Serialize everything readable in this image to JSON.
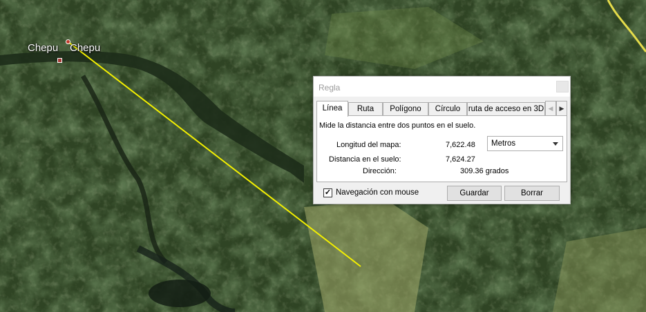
{
  "map": {
    "places": [
      {
        "name": "Chepu"
      },
      {
        "name": "Chepu"
      }
    ],
    "ruler_line_color": "#f4f000",
    "road_color": "#e5dc4a"
  },
  "dialog": {
    "title": "Regla",
    "tabs": [
      "Línea",
      "Ruta",
      "Polígono",
      "Círculo",
      "ruta de acceso en 3D"
    ],
    "active_tab": "Línea",
    "description": "Mide la distancia entre dos puntos en el suelo.",
    "map_length_label": "Longitud del mapa:",
    "map_length_value": "7,622.48",
    "unit": "Metros",
    "ground_distance_label": "Distancia en el suelo:",
    "ground_distance_value": "7,624.27",
    "heading_label": "Dirección:",
    "heading_value": "309.36 grados",
    "mouse_nav_label": "Navegación con mouse",
    "mouse_nav_checked": true,
    "save_label": "Guardar",
    "clear_label": "Borrar"
  }
}
